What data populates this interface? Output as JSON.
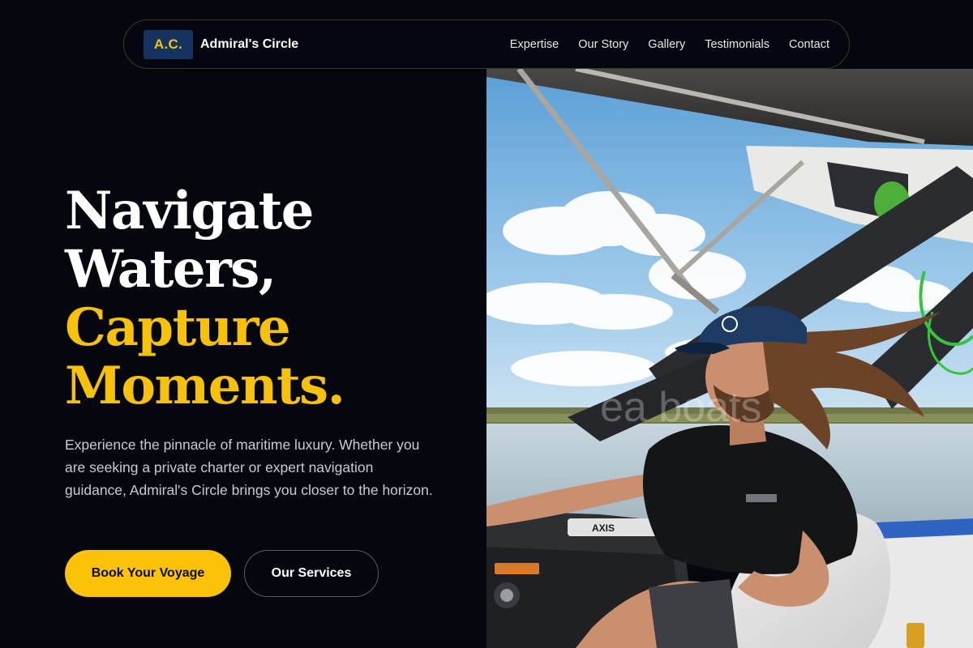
{
  "nav": {
    "logo_initials": "A.C.",
    "brand_name": "Admiral's Circle",
    "links": [
      "Expertise",
      "Our Story",
      "Gallery",
      "Testimonials",
      "Contact"
    ]
  },
  "hero": {
    "headline_line1": "Navigate",
    "headline_line2": "Waters,",
    "headline_line3": "Capture",
    "headline_line4": "Moments.",
    "description": "Experience the pinnacle of maritime luxury. Whether you are seeking a private charter or expert navigation guidance, Admiral's Circle brings you closer to the horizon.",
    "primary_cta": "Book Your Voyage",
    "secondary_cta": "Our Services",
    "image_watermark": "ea  boats",
    "boat_label": "AXIS"
  },
  "colors": {
    "background": "#05070f",
    "accent_gold": "#f7c108",
    "logo_badge": "#143361",
    "body_text": "#c9cad3"
  }
}
